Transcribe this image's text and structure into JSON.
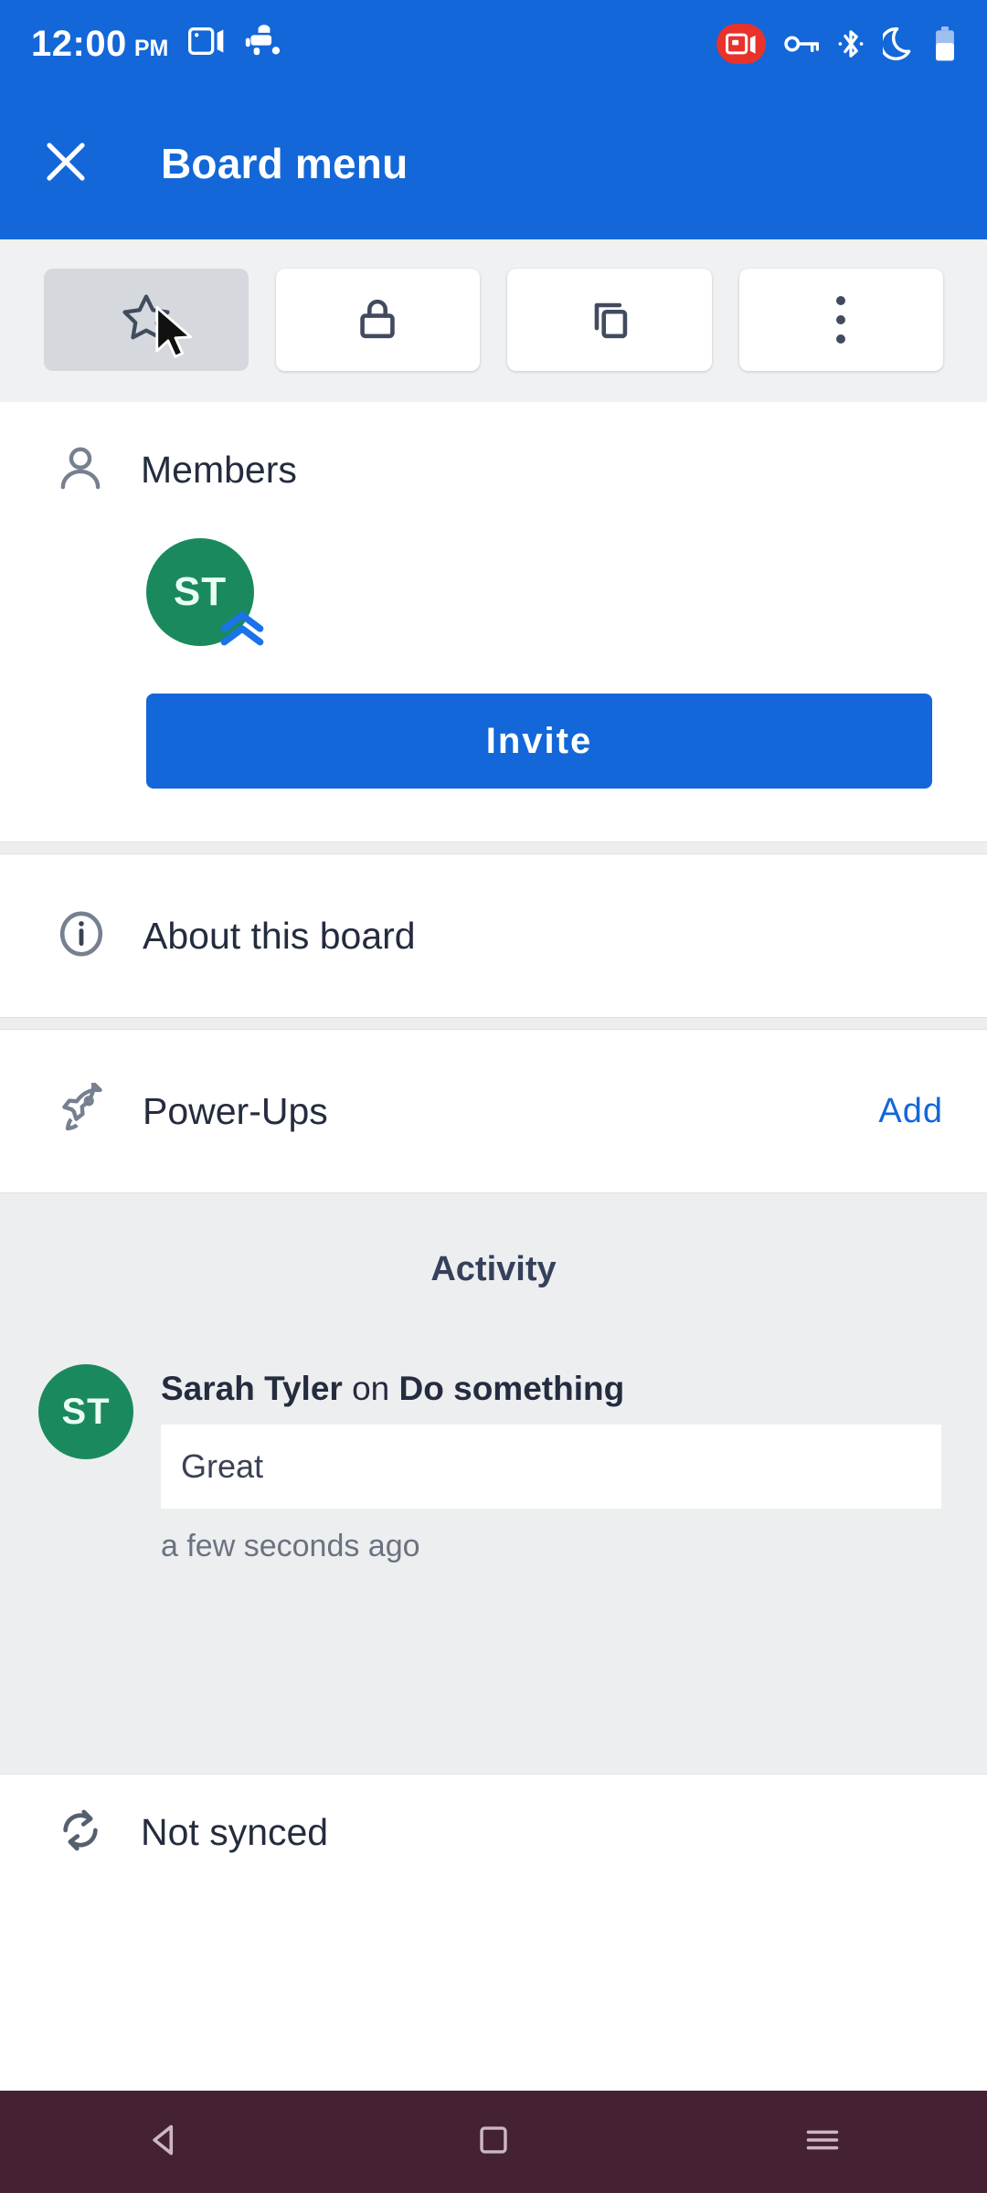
{
  "statusbar": {
    "time": "12:00",
    "ampm": "PM",
    "left_icons": [
      "screen-cast-icon",
      "android-figure-icon"
    ],
    "right_icons": [
      "screen-record-icon",
      "vpn-key-icon",
      "bluetooth-icon",
      "do-not-disturb-moon-icon",
      "battery-icon"
    ],
    "record_chip_color": "#e8322b",
    "bg_color": "#1367d8"
  },
  "appbar": {
    "close_icon": "close-icon",
    "title": "Board menu",
    "bg_color": "#1367d8"
  },
  "actions": [
    {
      "name": "star-board-button",
      "icon": "star-icon",
      "state": "pressed"
    },
    {
      "name": "lock-board-button",
      "icon": "lock-icon",
      "state": "default"
    },
    {
      "name": "copy-board-button",
      "icon": "copy-icon",
      "state": "default"
    },
    {
      "name": "more-options-button",
      "icon": "overflow-menu-icon",
      "state": "default"
    }
  ],
  "members": {
    "icon": "person-icon",
    "label": "Members",
    "avatar": {
      "initials": "ST",
      "color": "#1a8a5e",
      "badge": "admin-chevrons-icon"
    },
    "invite_label": "Invite",
    "invite_color": "#1367d8"
  },
  "about": {
    "icon": "info-icon",
    "label": "About this board"
  },
  "powerups": {
    "icon": "rocket-icon",
    "label": "Power-Ups",
    "action_label": "Add",
    "action_color": "#1367d8"
  },
  "activity": {
    "title": "Activity",
    "items": [
      {
        "avatar_initials": "ST",
        "avatar_color": "#1a8a5e",
        "author": "Sarah Tyler",
        "connector": " on ",
        "target": "Do something",
        "comment": "Great",
        "time": "a few seconds ago"
      }
    ]
  },
  "sync": {
    "icon": "sync-icon",
    "label": "Not synced"
  },
  "navbar": {
    "bg_color": "#442233",
    "back_icon": "back-triangle-icon",
    "home_icon": "home-square-icon",
    "recents_icon": "recents-lines-icon"
  }
}
